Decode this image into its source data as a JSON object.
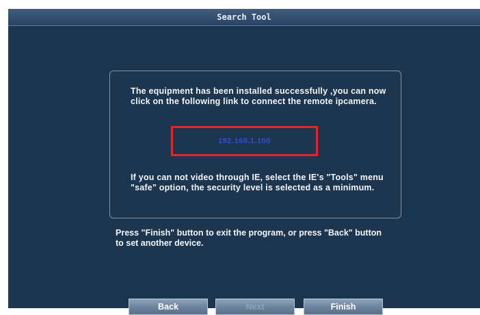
{
  "window": {
    "title": "Search Tool"
  },
  "info": {
    "message_top": "The equipment has been installed successfully ,you can now click on the following link to connect the remote ipcamera.",
    "link_text": "192.168.1.100",
    "message_bottom": "If you can not video through IE, select the IE's \"Tools\" menu  \"safe\" option, the security level is selected as a minimum."
  },
  "footer": {
    "message": "Press \"Finish\" button to exit the program, or press \"Back\" button to set another device."
  },
  "buttons": {
    "back": "Back",
    "next": "Next",
    "finish": "Finish"
  },
  "colors": {
    "background": "#1d3650",
    "highlight_border": "#e0262c",
    "link": "#2f4fd0"
  }
}
